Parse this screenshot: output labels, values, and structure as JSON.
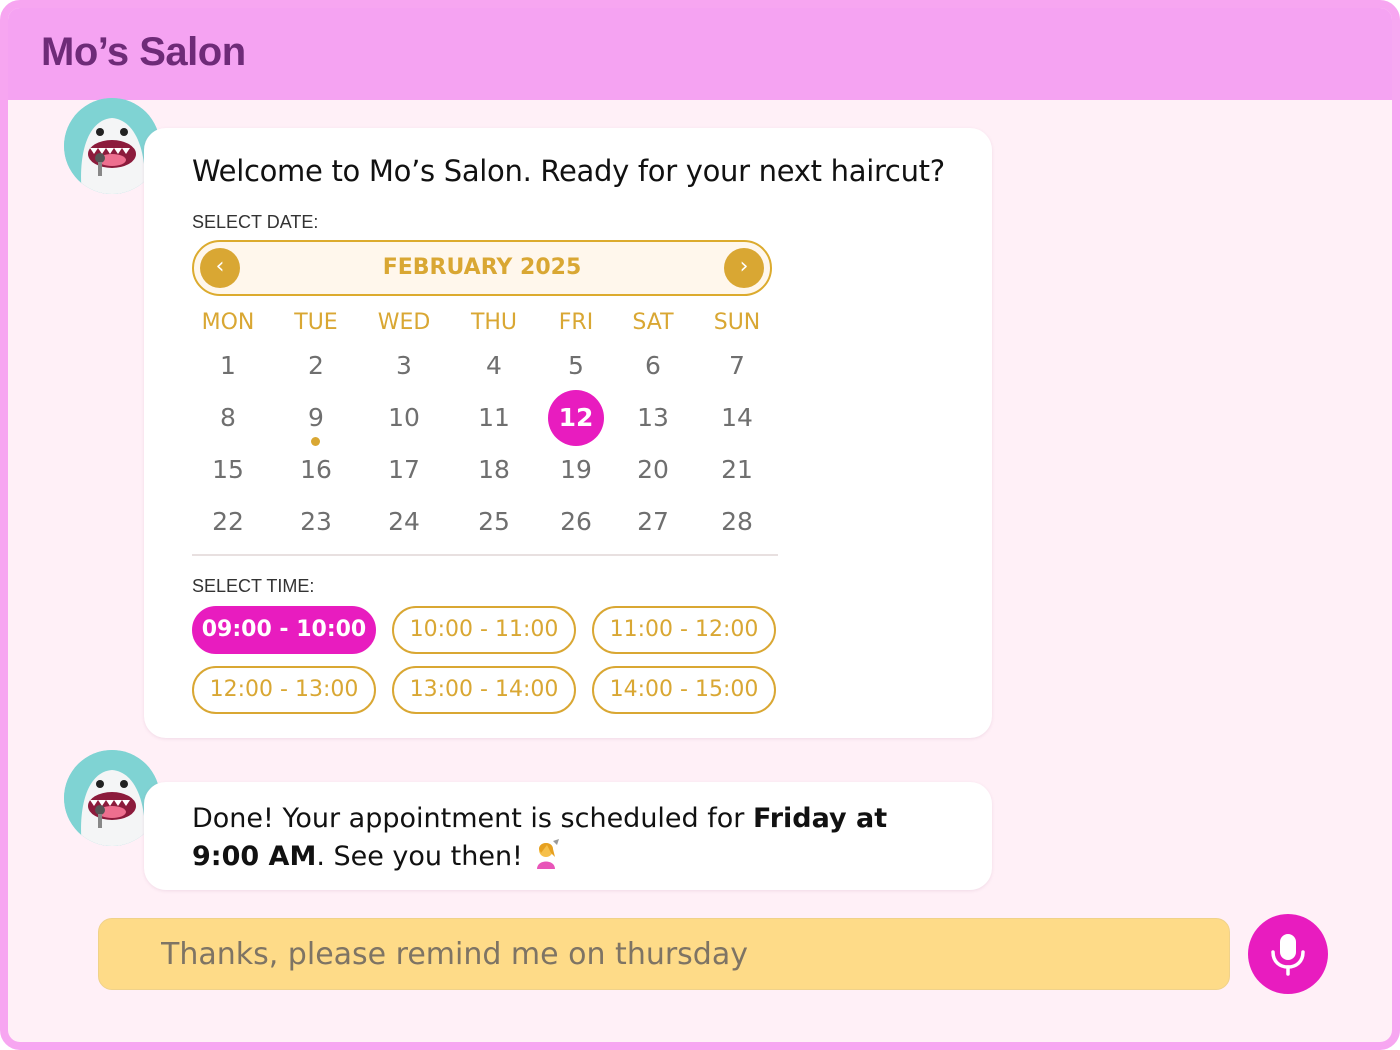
{
  "app": {
    "title": "Mo’s Salon"
  },
  "colors": {
    "header": "#f5a3f2",
    "accent_pink": "#e81cbf",
    "accent_gold": "#d9a733",
    "input_bg": "#fedb88"
  },
  "messages": [
    {
      "sender": "bot",
      "text": "Welcome to Mo’s Salon. Ready for your next haircut?",
      "date_picker": {
        "label": "SELECT DATE:",
        "month": "FEBRUARY 2025",
        "prev_icon": "chevron-left-icon",
        "next_icon": "chevron-right-icon",
        "weekdays": [
          "MON",
          "TUE",
          "WED",
          "THU",
          "FRI",
          "SAT",
          "SUN"
        ],
        "weeks": [
          [
            "1",
            "2",
            "3",
            "4",
            "5",
            "6",
            "7"
          ],
          [
            "8",
            "9",
            "10",
            "11",
            "12",
            "13",
            "14"
          ],
          [
            "15",
            "16",
            "17",
            "18",
            "19",
            "20",
            "21"
          ],
          [
            "22",
            "23",
            "24",
            "25",
            "26",
            "27",
            "28"
          ]
        ],
        "selected_day": "12",
        "marked_day": "9"
      },
      "time_picker": {
        "label": "SELECT TIME:",
        "slots": [
          "09:00 - 10:00",
          "10:00 - 11:00",
          "11:00 - 12:00",
          "12:00 - 13:00",
          "13:00 - 14:00",
          "14:00 - 15:00"
        ],
        "selected_slot": "09:00 - 10:00"
      }
    },
    {
      "sender": "bot",
      "text_parts": [
        "Done! Your appointment is scheduled for ",
        "Friday at 9:00 AM",
        ". See you then! "
      ],
      "emoji": "woman-getting-haircut-emoji"
    }
  ],
  "composer": {
    "value": "Thanks, please remind me on thursday",
    "mic_icon": "microphone-icon"
  }
}
